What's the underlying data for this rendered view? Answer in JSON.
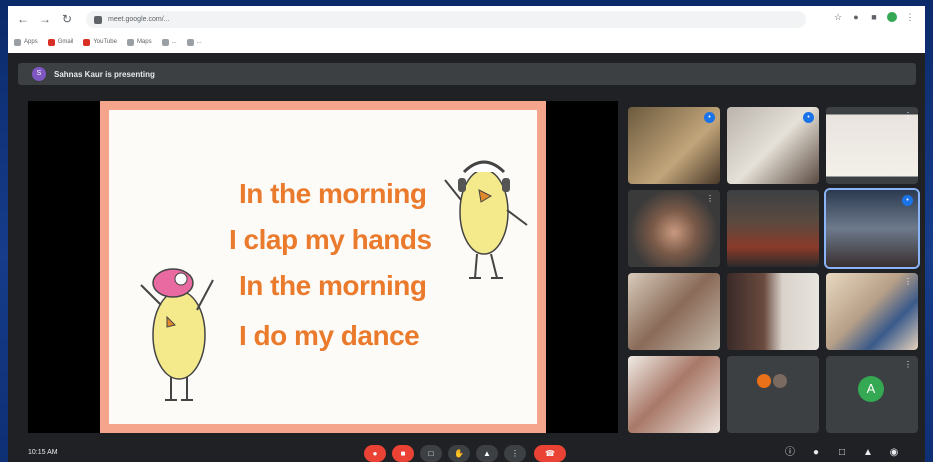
{
  "browser": {
    "address": "meet.google.com/...",
    "bookmarks": [
      "Apps",
      "Gmail",
      "YouTube",
      "Maps",
      "...",
      "..."
    ]
  },
  "banner": {
    "avatar_letter": "S",
    "text": "Sahnas Kaur is presenting"
  },
  "slide": {
    "lines": [
      "In the morning",
      "I clap my hands",
      "In the morning",
      "I do my dance"
    ]
  },
  "participants": [
    {
      "name": "",
      "state": "video",
      "speaking": true
    },
    {
      "name": "",
      "state": "video",
      "speaking": true
    },
    {
      "name": "",
      "state": "video"
    },
    {
      "name": "",
      "state": "video"
    },
    {
      "name": "",
      "state": "video"
    },
    {
      "name": "",
      "state": "video",
      "active": true
    },
    {
      "name": "",
      "state": "video"
    },
    {
      "name": "",
      "state": "video"
    },
    {
      "name": "",
      "state": "video"
    },
    {
      "name": "",
      "state": "video"
    },
    {
      "name": "",
      "state": "avatars"
    },
    {
      "name": "",
      "state": "avatar",
      "avatar_letter": "A"
    }
  ],
  "bottom": {
    "time": "10:15 AM",
    "code": ""
  },
  "colors": {
    "slide_text": "#ea7a2c",
    "slide_border": "#f4a58c",
    "red_control": "#ea4335",
    "active_tile": "#8ab4f8"
  }
}
